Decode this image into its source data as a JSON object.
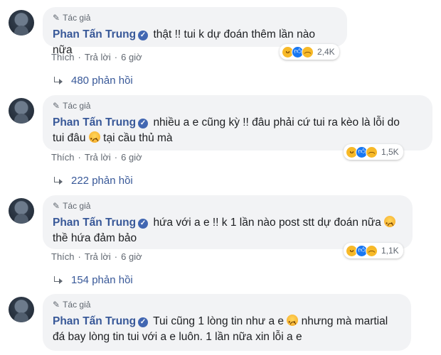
{
  "author_tag": "Tác giả",
  "author_name": "Phan Tấn Trung",
  "actions": {
    "like": "Thích",
    "reply": "Trả lời"
  },
  "comments": [
    {
      "lines": [
        "thật !! tui k dự đoán thêm lần nào nữa"
      ],
      "time": "6 giờ",
      "reaction_count": "2,4K",
      "reaction_icons": [
        "haha-icon",
        "like-icon",
        "sad-icon"
      ],
      "replies": "480 phản hồi"
    },
    {
      "lines": [
        "nhiều a e cũng kỳ !! đâu phải cứ tui ra kèo là lỗi do",
        "tui đâu",
        "tại cầu thủ mà"
      ],
      "time": "6 giờ",
      "reaction_count": "1,5K",
      "reaction_icons": [
        "haha-icon",
        "like-icon",
        "sad-icon"
      ],
      "replies": "222 phản hồi"
    },
    {
      "lines": [
        "hứa với a e !! k 1 lần nào post stt dự đoán nữa",
        "thề hứa đảm bảo"
      ],
      "time": "6 giờ",
      "reaction_count": "1,1K",
      "reaction_icons": [
        "haha-icon",
        "like-icon",
        "sad-icon"
      ],
      "replies": "154 phản hồi"
    },
    {
      "lines": [
        "Tui cũng 1 lòng tin như a e",
        "nhưng mà martial",
        "đá bay lòng tin tui với a e luôn. 1 lần nữa xin lỗi a e"
      ]
    }
  ]
}
